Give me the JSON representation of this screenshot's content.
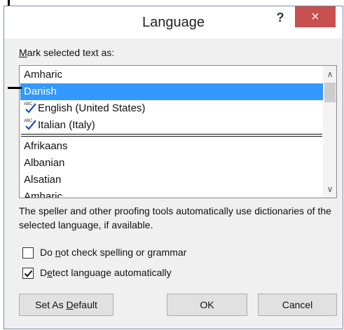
{
  "window": {
    "title": "Language",
    "help_label": "?",
    "close_label": "×"
  },
  "list_label": "Mark selected text as:",
  "languages": {
    "recent": [
      {
        "label": "Amharic",
        "spell_check": false,
        "selected": false
      },
      {
        "label": "Danish",
        "spell_check": false,
        "selected": true
      },
      {
        "label": "English (United States)",
        "spell_check": true,
        "selected": false
      },
      {
        "label": "Italian (Italy)",
        "spell_check": true,
        "selected": false
      }
    ],
    "all": [
      {
        "label": "Afrikaans"
      },
      {
        "label": "Albanian"
      },
      {
        "label": "Alsatian"
      },
      {
        "label": "Amharic"
      }
    ]
  },
  "description": "The speller and other proofing tools automatically use dictionaries of the selected language, if available.",
  "options": {
    "no_check": {
      "label": "Do not check spelling or grammar",
      "checked": false
    },
    "detect": {
      "label": "Detect language automatically",
      "checked": true
    }
  },
  "buttons": {
    "set_default": "Set As Default",
    "ok": "OK",
    "cancel": "Cancel"
  },
  "colors": {
    "selection": "#3399ff",
    "close": "#c75050",
    "spell_check_mark": "#1a50c8"
  }
}
